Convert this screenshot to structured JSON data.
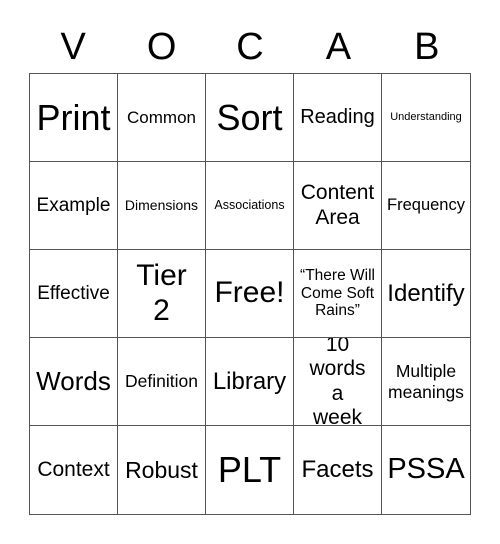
{
  "header": [
    "V",
    "O",
    "C",
    "A",
    "B"
  ],
  "cells": [
    "Print",
    "Common",
    "Sort",
    "Reading",
    "Understanding",
    "Example",
    "Dimensions",
    "Associations",
    "Content Area",
    "Frequency",
    "Effective",
    "Tier 2",
    "Free!",
    "“There Will Come Soft Rains”",
    "Identify",
    "Words",
    "Definition",
    "Library",
    "10 words a week",
    "Multiple meanings",
    "Context",
    "Robust",
    "PLT",
    "Facets",
    "PSSA"
  ]
}
